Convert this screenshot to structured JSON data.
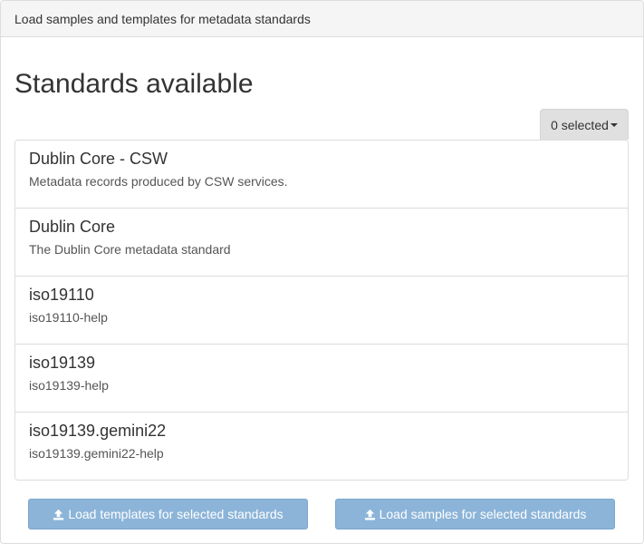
{
  "panel": {
    "heading": "Load samples and templates for metadata standards"
  },
  "main": {
    "title": "Standards available",
    "dropdown_label": "0 selected"
  },
  "standards": [
    {
      "name": "Dublin Core - CSW",
      "description": "Metadata records produced by CSW services."
    },
    {
      "name": "Dublin Core",
      "description": "The Dublin Core metadata standard"
    },
    {
      "name": "iso19110",
      "description": "iso19110-help"
    },
    {
      "name": "iso19139",
      "description": "iso19139-help"
    },
    {
      "name": "iso19139.gemini22",
      "description": "iso19139.gemini22-help"
    }
  ],
  "actions": {
    "load_templates_label": "Load templates for selected standards",
    "load_samples_label": "Load samples for selected standards",
    "icon": "upload-icon"
  },
  "colors": {
    "primary_button": "#8cb4d8",
    "heading_bg": "#f5f5f5",
    "dropdown_bg": "#e0e0e0"
  }
}
